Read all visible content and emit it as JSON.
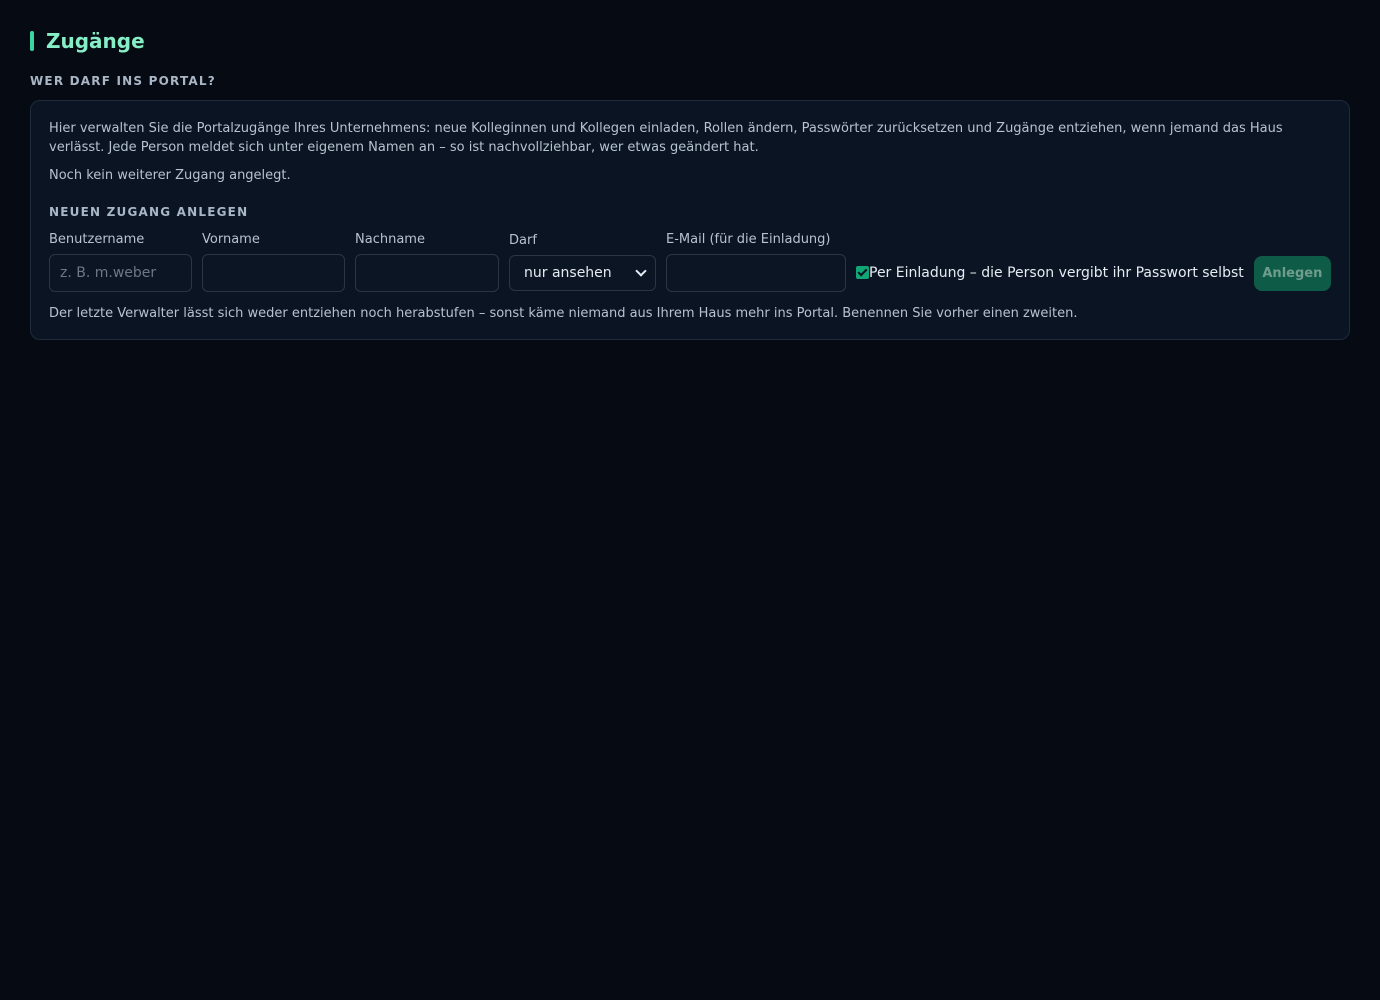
{
  "header": {
    "title": "Zugänge"
  },
  "section": {
    "heading": "WER DARF INS PORTAL?"
  },
  "card": {
    "intro": "Hier verwalten Sie die Portalzugänge Ihres Unternehmens: neue Kolleginnen und Kollegen einladen, Rollen ändern, Passwörter zurücksetzen und Zugänge entziehen, wenn jemand das Haus verlässt. Jede Person meldet sich unter eigenem Namen an – so ist nachvollziehbar, wer etwas geändert hat.",
    "empty_note": "Noch kein weiterer Zugang angelegt.",
    "form_heading": "NEUEN ZUGANG ANLEGEN",
    "footnote": "Der letzte Verwalter lässt sich weder entziehen noch herabstufen – sonst käme niemand aus Ihrem Haus mehr ins Portal. Benennen Sie vorher einen zweiten."
  },
  "form": {
    "username": {
      "label": "Benutzername",
      "value": "",
      "placeholder": "z. B. m.weber"
    },
    "firstname": {
      "label": "Vorname",
      "value": "",
      "placeholder": ""
    },
    "lastname": {
      "label": "Nachname",
      "value": "",
      "placeholder": ""
    },
    "role": {
      "label": "Darf",
      "selected": "nur ansehen"
    },
    "email": {
      "label": "E-Mail (für die Einladung)",
      "value": "",
      "placeholder": ""
    },
    "invite": {
      "label": "Per Einladung – die Person vergibt ihr Passwort selbst",
      "checked": true
    },
    "submit_label": "Anlegen"
  },
  "colors": {
    "accent": "#3dd6a0",
    "title": "#86eec6",
    "background": "#060a12",
    "card": "#0a1422",
    "button": "#0e5c47"
  },
  "icons": {
    "select": "chevron-down-icon",
    "checkbox": "checkmark-icon"
  }
}
